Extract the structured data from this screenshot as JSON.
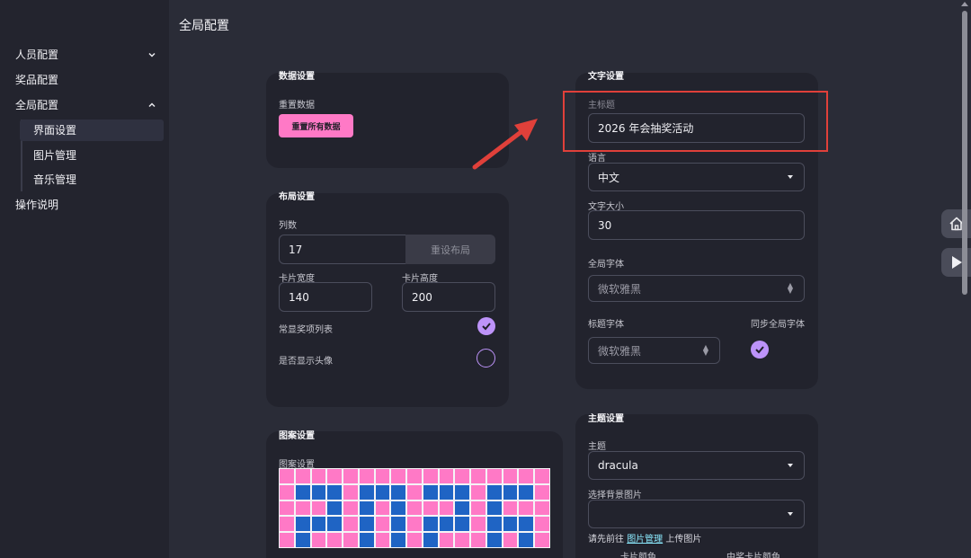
{
  "sidebar": {
    "items": [
      {
        "label": "人员配置"
      },
      {
        "label": "奖品配置"
      },
      {
        "label": "全局配置"
      },
      {
        "label": "界面设置"
      },
      {
        "label": "图片管理"
      },
      {
        "label": "音乐管理"
      },
      {
        "label": "操作说明"
      }
    ]
  },
  "page_title": "全局配置",
  "data_card": {
    "title": "数据设置",
    "reset_label": "重置数据",
    "reset_button": "重置所有数据"
  },
  "layout_card": {
    "title": "布局设置",
    "columns_label": "列数",
    "columns_value": "17",
    "reset_layout_button": "重设布局",
    "card_width_label": "卡片宽度",
    "card_width_value": "140",
    "card_height_label": "卡片高度",
    "card_height_value": "200",
    "show_prize_list_label": "常显奖项列表",
    "show_prize_list_checked": true,
    "show_avatar_label": "是否显示头像",
    "show_avatar_checked": false
  },
  "pattern_card": {
    "title": "图案设置",
    "pattern_label": "图案设置",
    "colors": {
      "pink": "#ff79c6",
      "blue": "#1f64c4"
    },
    "rows": [
      "ppppppppppppppppp",
      "pbbbpbbbpbbbpbbbp",
      "pppbpbpbpppbpbppp",
      "pbbbpbpbpbbbpbbbp",
      "pbpppbpbpbpppbpbp"
    ]
  },
  "text_card": {
    "title": "文字设置",
    "main_title_label": "主标题",
    "main_title_value": "2026 年会抽奖活动",
    "language_label": "语言",
    "language_value": "中文",
    "font_size_label": "文字大小",
    "font_size_value": "30",
    "global_font_label": "全局字体",
    "global_font_value": "微软雅黑",
    "title_font_label": "标题字体",
    "title_font_value": "微软雅黑",
    "sync_font_label": "同步全局字体",
    "sync_font_checked": true
  },
  "theme_card": {
    "title": "主题设置",
    "theme_label": "主题",
    "theme_value": "dracula",
    "bg_image_label": "选择背景图片",
    "bg_image_value": "",
    "hint_prefix": "请先前往",
    "hint_link": "图片管理",
    "hint_suffix": "上传图片",
    "card_color_label": "卡片颜色",
    "win_card_color_label": "中奖卡片颜色"
  },
  "icons": [
    "chevron-down-icon",
    "chevron-up-icon",
    "check-icon",
    "home-icon",
    "play-icon",
    "dropdown-arrow-icon",
    "arrow-annotation-icon"
  ],
  "accent_colors": {
    "pink": "#ff79c6",
    "purple": "#bd93f9",
    "annotation_red": "#e0403a"
  }
}
